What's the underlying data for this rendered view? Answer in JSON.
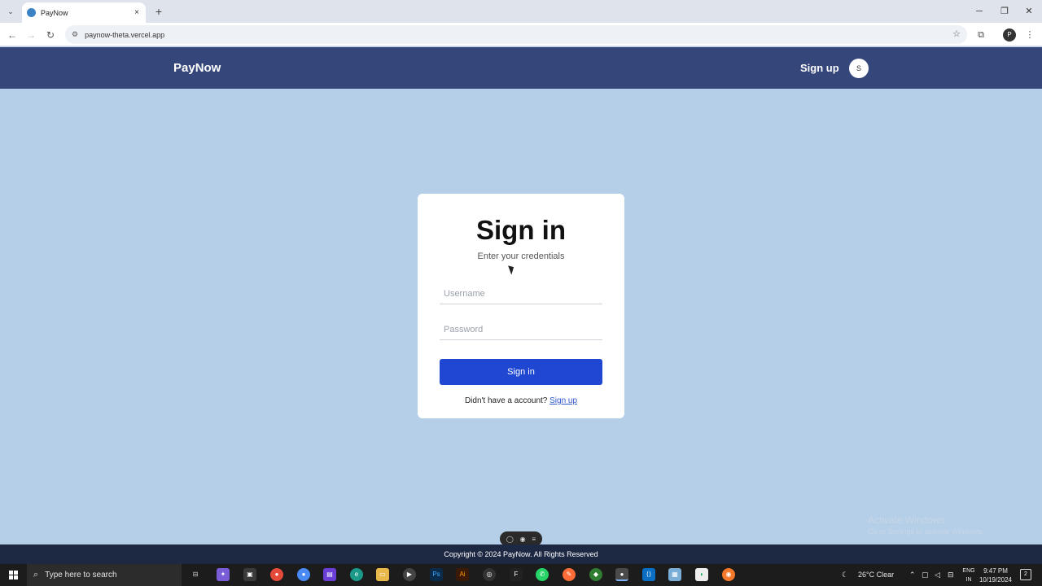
{
  "browser": {
    "tab_title": "PayNow",
    "url": "paynow-theta.vercel.app",
    "tab_close": "×",
    "new_tab": "+",
    "menu": "⌄"
  },
  "app": {
    "brand": "PayNow",
    "nav_signup": "Sign up",
    "avatar_initial": "S"
  },
  "signin": {
    "title": "Sign in",
    "subtitle": "Enter your credentials",
    "username_placeholder": "Username",
    "password_placeholder": "Password",
    "button_label": "Sign in",
    "footer_text": "Didn't have a account?",
    "footer_link": "Sign up"
  },
  "footer": {
    "copyright": "Copyright © 2024 PayNow. All Rights Reserved"
  },
  "watermark": {
    "line1": "Activate Windows",
    "line2": "Go to Settings to activate Windows."
  },
  "taskbar": {
    "search_placeholder": "Type here to search",
    "weather": "26°C  Clear",
    "lang_top": "ENG",
    "lang_bottom": "IN",
    "time": "9:47 PM",
    "date": "10/19/2024",
    "apps": [
      "task-view",
      "copilot",
      "store",
      "chrome",
      "chrome-profile",
      "jetbrains",
      "edge",
      "file-explorer",
      "media-player",
      "photoshop",
      "illustrator",
      "obs",
      "figma",
      "whatsapp",
      "postman",
      "node",
      "chrome-active",
      "vscode",
      "notepad",
      "mongodb",
      "blender"
    ]
  },
  "colors": {
    "page_bg": "#b5cfe9",
    "navbar_bg": "#34467a",
    "button_bg": "#1f47d1",
    "footer_bg": "#1d2843"
  }
}
